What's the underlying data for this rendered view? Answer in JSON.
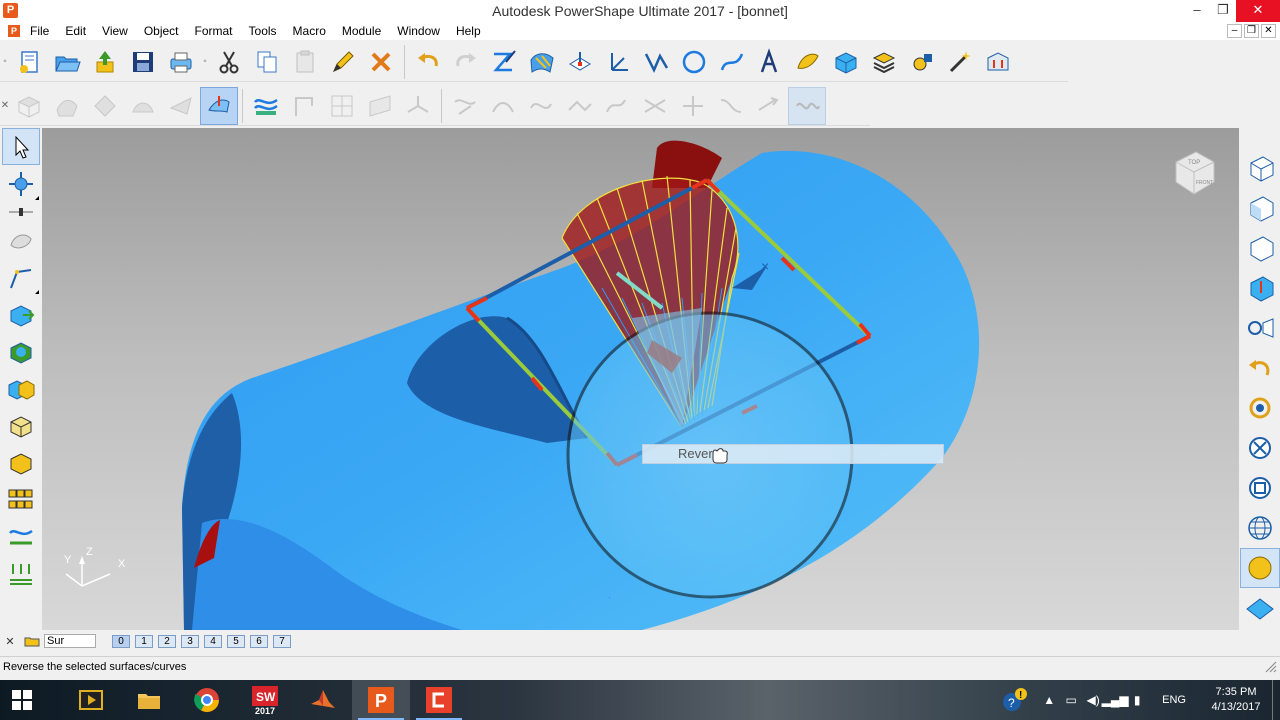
{
  "window": {
    "app_icon_letter": "P",
    "title": "Autodesk PowerShape Ultimate 2017 - [bonnet]",
    "controls": [
      "–",
      "❐",
      "✕"
    ]
  },
  "menu": {
    "logo_letter": "P",
    "items": [
      "File",
      "Edit",
      "View",
      "Object",
      "Format",
      "Tools",
      "Macro",
      "Module",
      "Window",
      "Help"
    ]
  },
  "viewport": {
    "tooltip_text": "Rever",
    "viewcube_top": "TOP",
    "viewcube_front": "FRONT",
    "triad": {
      "x": "X",
      "y": "Y",
      "z": "Z"
    }
  },
  "levelbar": {
    "close_symbol": "✕",
    "level_name": "Sur",
    "levels": [
      "0",
      "1",
      "2",
      "3",
      "4",
      "5",
      "6",
      "7"
    ],
    "selected_level": "0"
  },
  "statusbar": {
    "message": "Reverse the selected surfaces/curves"
  },
  "taskbar": {
    "clock_time": "7:35 PM",
    "clock_date": "4/13/2017",
    "language": "ENG",
    "solidworks_label": "2017",
    "tray_arrow": "▲"
  },
  "colors": {
    "surface_blue": "#2f9af0",
    "surface_dark": "#1f5fa8",
    "highlight_red": "#8a0f0f",
    "wire_yellow": "#f0e040",
    "frame_red": "#e8321a",
    "frame_green": "#9acb3c",
    "taskbar_dark": "#1a2530",
    "close_red": "#e81123"
  }
}
